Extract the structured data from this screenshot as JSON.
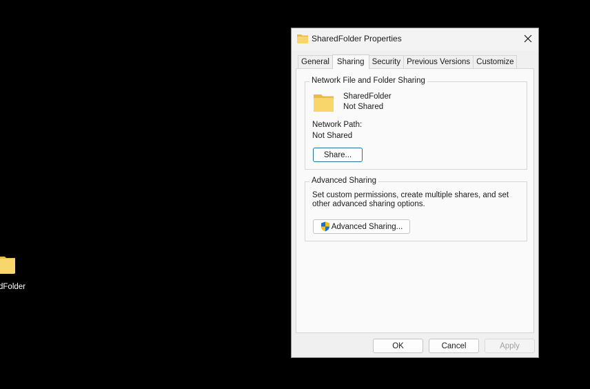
{
  "desktop": {
    "icon_label": "dFolder"
  },
  "dialog": {
    "title": "SharedFolder Properties",
    "close_icon": "close-icon",
    "tabs": [
      {
        "label": "General"
      },
      {
        "label": "Sharing"
      },
      {
        "label": "Security"
      },
      {
        "label": "Previous Versions"
      },
      {
        "label": "Customize"
      }
    ],
    "active_tab": "Sharing",
    "network_sharing": {
      "legend": "Network File and Folder Sharing",
      "folder_name": "SharedFolder",
      "folder_status": "Not Shared",
      "network_path_label": "Network Path:",
      "network_path_value": "Not Shared",
      "share_button": "Share..."
    },
    "advanced_sharing": {
      "legend": "Advanced Sharing",
      "description": "Set custom permissions, create multiple shares, and set other advanced sharing options.",
      "button": "Advanced Sharing..."
    },
    "footer": {
      "ok": "OK",
      "cancel": "Cancel",
      "apply": "Apply"
    }
  },
  "colors": {
    "folder_yellow": "#f6cf5a",
    "focus_border": "#1f6f9e",
    "shield_blue": "#1e6fc8",
    "shield_yellow": "#f4c20d"
  }
}
